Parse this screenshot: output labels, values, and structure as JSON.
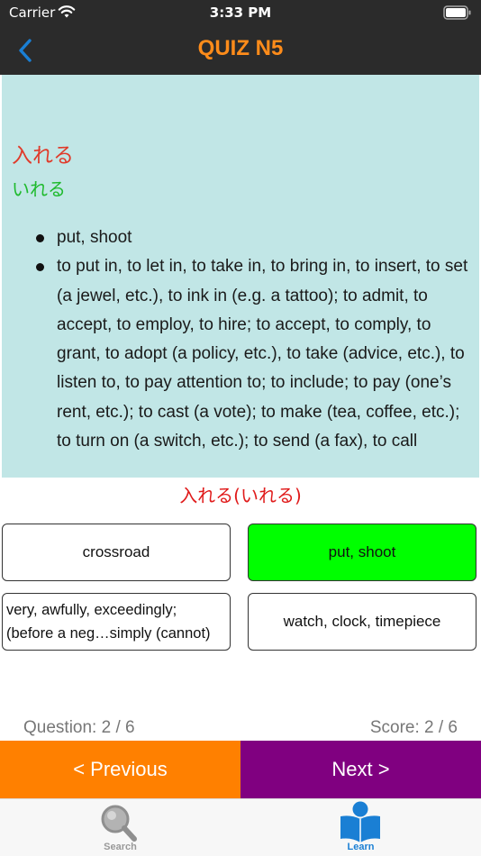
{
  "status": {
    "carrier": "Carrier",
    "time": "3:33 PM"
  },
  "nav": {
    "title": "QUIZ N5",
    "back_icon": "chevron-left-icon"
  },
  "word": {
    "kanji": "入れる",
    "kana": "いれる",
    "meanings": [
      "put, shoot",
      "to put in, to let in, to take in, to bring in, to insert, to set (a jewel, etc.), to ink in (e.g. a tattoo); to admit, to accept, to employ, to hire; to accept, to comply, to grant, to adopt (a policy, etc.), to take (advice, etc.), to listen to, to pay attention to; to include; to pay (one’s rent, etc.); to cast (a vote); to make (tea, coffee, etc.); to turn on (a switch, etc.); to send (a fax), to call"
    ]
  },
  "answer": "入れる(いれる)",
  "options": [
    {
      "label": "crossroad",
      "state": "default"
    },
    {
      "label": "put, shoot",
      "state": "correct"
    },
    {
      "label": "very, awfully, exceedingly; (before a neg…simply (cannot)",
      "state": "default"
    },
    {
      "label": "watch, clock, timepiece",
      "state": "default"
    }
  ],
  "progress": {
    "question": "Question: 2 / 6",
    "score": "Score: 2 / 6"
  },
  "buttons": {
    "previous": "< Previous",
    "next": "Next >"
  },
  "tabs": [
    {
      "label": "Search",
      "icon": "magnifier-icon",
      "active": false
    },
    {
      "label": "Learn",
      "icon": "reader-icon",
      "active": true
    }
  ],
  "colors": {
    "bar_background": "#2b2b2b",
    "title": "#ff8c1a",
    "panel": "#c1e6e6",
    "kanji": "#e03a2a",
    "kana": "#1fba2e",
    "answer": "#e01b1b",
    "correct_option": "#00ff00",
    "previous_button": "#ff8000",
    "next_button": "#800080",
    "active_tab": "#1a7fd4"
  }
}
